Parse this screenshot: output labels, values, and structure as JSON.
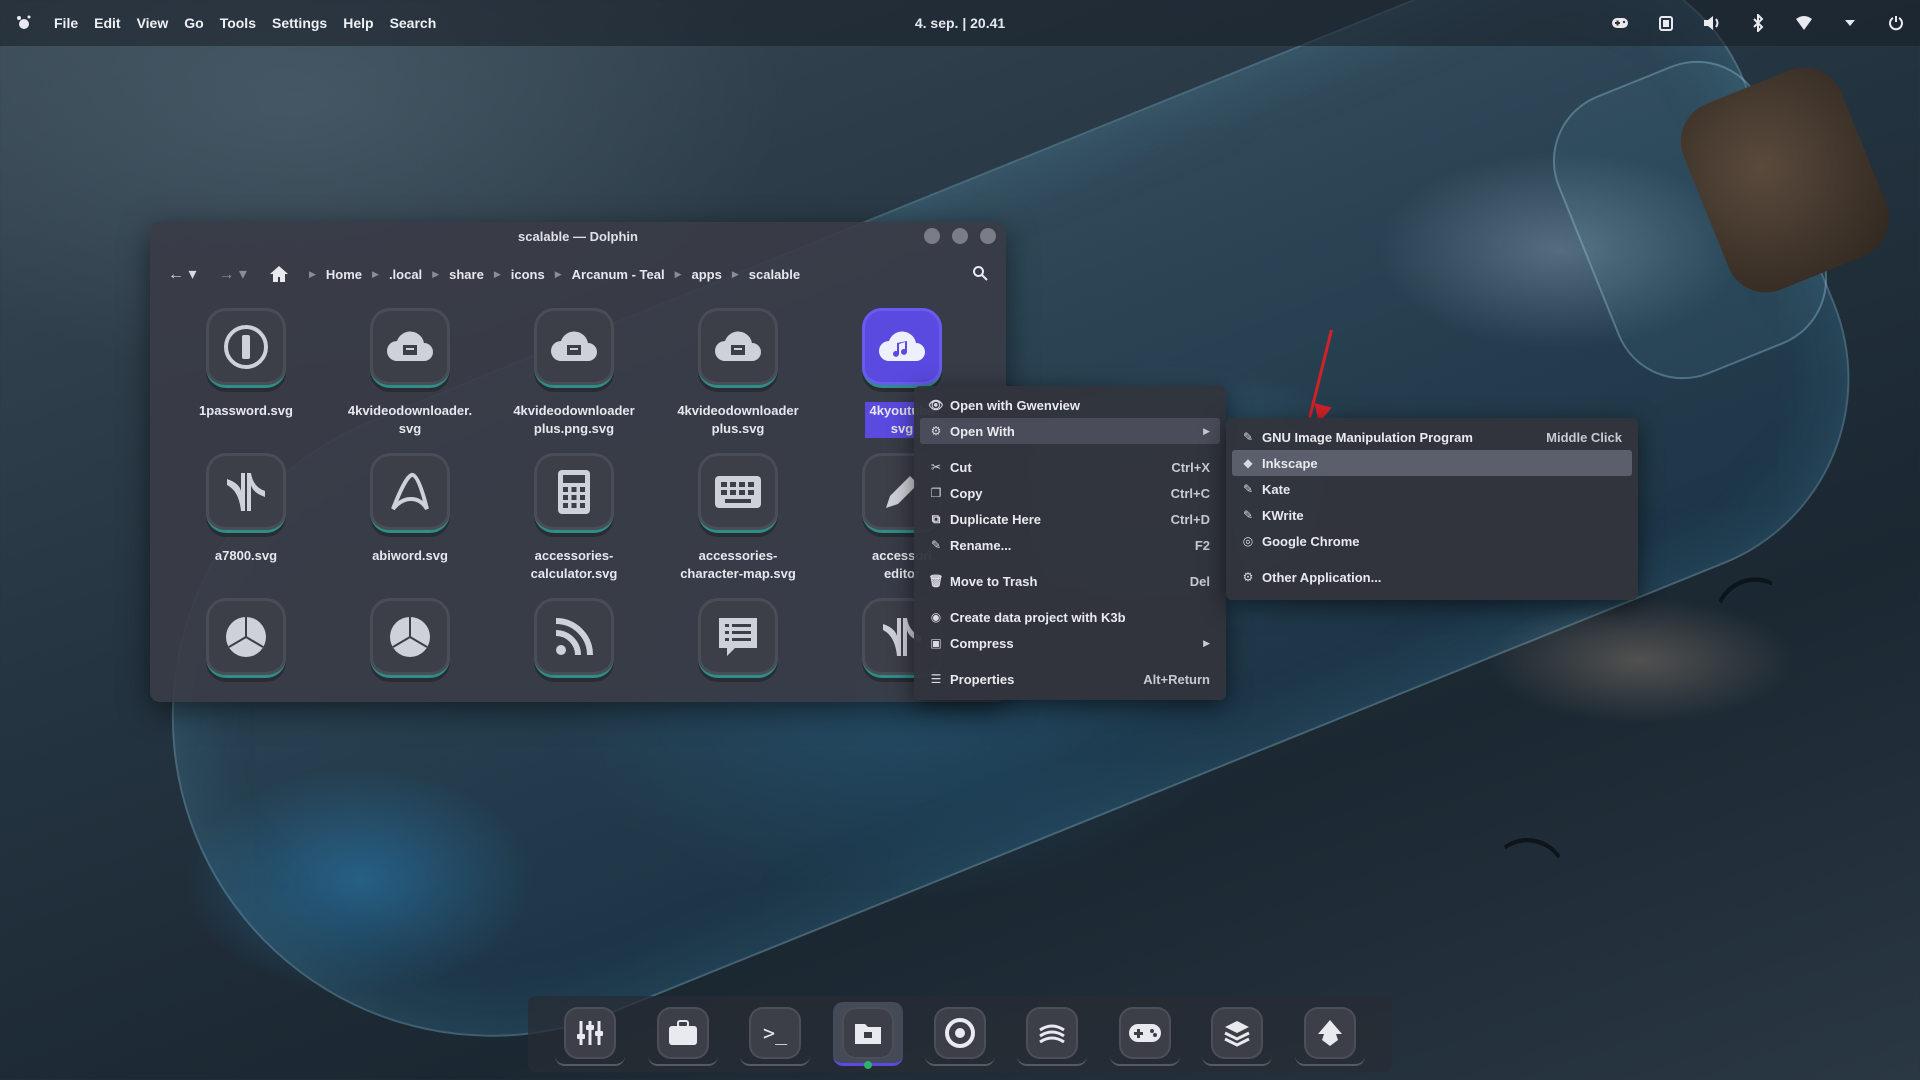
{
  "top_panel": {
    "menus": [
      "File",
      "Edit",
      "View",
      "Go",
      "Tools",
      "Settings",
      "Help",
      "Search"
    ],
    "clock": "4. sep. | 20.41",
    "tray_icons": [
      "gamepad-icon",
      "clipboard-icon",
      "volume-icon",
      "bluetooth-icon",
      "wifi-icon",
      "chevron-down-icon",
      "power-icon"
    ]
  },
  "window": {
    "title": "scalable — Dolphin",
    "breadcrumb": [
      "Home",
      ".local",
      "share",
      "icons",
      "Arcanum - Teal",
      "apps",
      "scalable"
    ],
    "files": [
      {
        "name": "1password.svg",
        "icon": "1password-icon"
      },
      {
        "name": "4kvideodownloader.\nsvg",
        "icon": "cloud-download-icon"
      },
      {
        "name": "4kvideodownloader\nplus.png.svg",
        "icon": "cloud-download-icon"
      },
      {
        "name": "4kvideodownloader\nplus.svg",
        "icon": "cloud-download-icon"
      },
      {
        "name": "4kyoutube\nsvg",
        "icon": "cloud-music-icon",
        "selected": true
      },
      {
        "name": "a7800.svg",
        "icon": "atari-icon"
      },
      {
        "name": "abiword.svg",
        "icon": "abiword-icon"
      },
      {
        "name": "accessories-\ncalculator.svg",
        "icon": "calculator-icon"
      },
      {
        "name": "accessories-\ncharacter-map.svg",
        "icon": "keyboard-icon"
      },
      {
        "name": "accessori\neditor",
        "icon": "pencil-icon"
      },
      {
        "name": "",
        "icon": "pie-chart-icon"
      },
      {
        "name": "",
        "icon": "pie-chart-icon"
      },
      {
        "name": "",
        "icon": "rss-icon"
      },
      {
        "name": "",
        "icon": "list-icon"
      },
      {
        "name": "",
        "icon": "atari-icon"
      }
    ]
  },
  "context_menu": {
    "items": [
      {
        "label": "Open with Gwenview",
        "icon": "eye-icon",
        "shortcut": ""
      },
      {
        "label": "Open With",
        "icon": "apps-icon",
        "shortcut": "",
        "submenu": true
      },
      {
        "label": "Cut",
        "icon": "scissors-icon",
        "shortcut": "Ctrl+X"
      },
      {
        "label": "Copy",
        "icon": "copy-icon",
        "shortcut": "Ctrl+C"
      },
      {
        "label": "Duplicate Here",
        "icon": "duplicate-icon",
        "shortcut": "Ctrl+D"
      },
      {
        "label": "Rename...",
        "icon": "rename-icon",
        "shortcut": "F2"
      },
      {
        "label": "Move to Trash",
        "icon": "trash-icon",
        "shortcut": "Del"
      },
      {
        "label": "Create data project with K3b",
        "icon": "disc-icon",
        "shortcut": ""
      },
      {
        "label": "Compress",
        "icon": "archive-icon",
        "shortcut": "",
        "submenu": true
      },
      {
        "label": "Properties",
        "icon": "properties-icon",
        "shortcut": "Alt+Return"
      }
    ]
  },
  "submenu": {
    "items": [
      {
        "label": "GNU Image Manipulation Program",
        "icon": "pencil-icon",
        "shortcut": "Middle Click"
      },
      {
        "label": "Inkscape",
        "icon": "inkscape-icon",
        "shortcut": ""
      },
      {
        "label": "Kate",
        "icon": "pencil-icon",
        "shortcut": ""
      },
      {
        "label": "KWrite",
        "icon": "pencil-icon",
        "shortcut": ""
      },
      {
        "label": "Google Chrome",
        "icon": "chrome-icon",
        "shortcut": ""
      },
      {
        "label": "Other Application...",
        "icon": "apps-icon",
        "shortcut": ""
      }
    ]
  },
  "dock": {
    "items": [
      "mixer-icon",
      "briefcase-icon",
      "terminal-icon",
      "folder-icon",
      "chrome-icon",
      "rss-icon",
      "gamepad-icon",
      "layers-icon",
      "inkscape-icon"
    ],
    "active_index": 3,
    "terminal_text": ">_"
  },
  "colors": {
    "accent": "#5a4ae0",
    "teal": "#2d8f8a",
    "arrow": "#d0222a"
  }
}
